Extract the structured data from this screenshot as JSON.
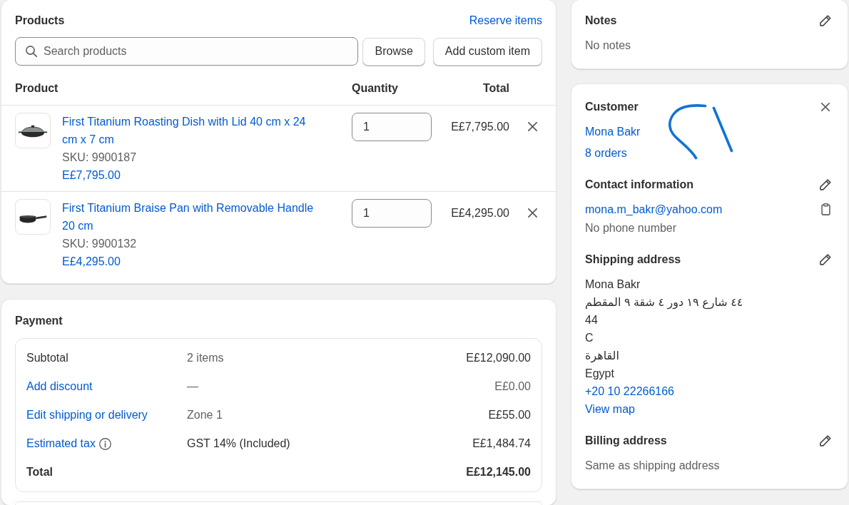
{
  "products": {
    "title": "Products",
    "reserve_link": "Reserve items",
    "search": {
      "placeholder": "Search products"
    },
    "buttons": [
      "Browse",
      "Add custom item"
    ],
    "columns": [
      "Product",
      "Quantity",
      "Total"
    ],
    "items": [
      {
        "kind": "dish",
        "name": "First Titanium Roasting Dish with Lid 40 cm x 24 cm x 7 cm",
        "sku": "SKU: 9900187",
        "price": "E£7,795.00",
        "quantity": "1",
        "total": "E£7,795.00"
      },
      {
        "kind": "pan",
        "name": "First Titanium Braise Pan with Removable Handle 20 cm",
        "sku": "SKU: 9900132",
        "price": "E£4,295.00",
        "quantity": "1",
        "total": "E£4,295.00"
      }
    ]
  },
  "payment": {
    "title": "Payment",
    "rows": [
      {
        "kind": "plain",
        "label": "Subtotal",
        "info": false,
        "detail": "2 items",
        "detail_muted": true,
        "value": "E£12,090.00",
        "value_muted": false
      },
      {
        "kind": "link",
        "label": "Add discount",
        "info": false,
        "detail": "—",
        "detail_muted": true,
        "value": "E£0.00",
        "value_muted": true
      },
      {
        "kind": "link",
        "label": "Edit shipping or delivery",
        "info": false,
        "detail": "Zone 1",
        "detail_muted": true,
        "value": "E£55.00",
        "value_muted": false
      },
      {
        "kind": "link",
        "label": "Estimated tax",
        "info": true,
        "detail": "GST 14% (Included)",
        "detail_muted": false,
        "value": "E£1,484.74",
        "value_muted": false
      },
      {
        "kind": "total",
        "label": "Total",
        "info": false,
        "value": "E£12,145.00",
        "value_muted": false
      }
    ]
  },
  "notes": {
    "title": "Notes",
    "text": "No notes"
  },
  "customer": {
    "title": "Customer",
    "name": "Mona Bakr",
    "orders": "8 orders",
    "contact": {
      "title": "Contact information",
      "email": "mona.m_bakr@yahoo.com",
      "phone": "No phone number"
    },
    "shipping": {
      "title": "Shipping address",
      "lines": [
        "Mona Bakr",
        "٤٤ شارع ١٩ دور ٤ شقة ٩ المقطم",
        "44",
        "C",
        "القاهرة",
        "Egypt"
      ],
      "phone": "+20 10 22266166",
      "map_link": "View map"
    },
    "billing": {
      "title": "Billing address",
      "text": "Same as shipping address"
    }
  }
}
